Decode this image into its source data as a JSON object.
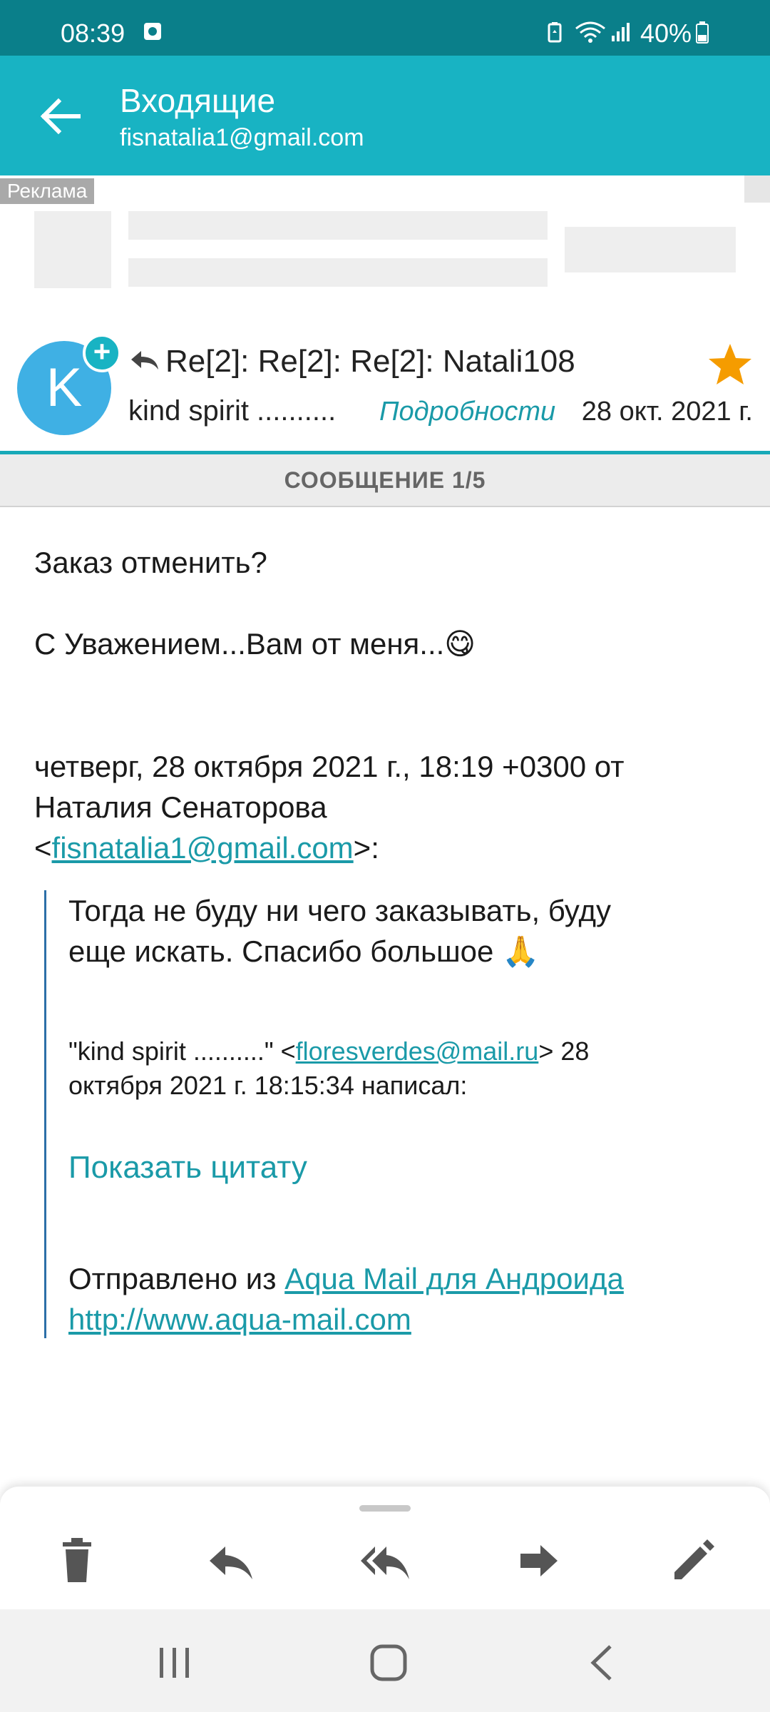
{
  "status_bar": {
    "time": "08:39",
    "battery": "40%",
    "icons": [
      "screenshot-icon",
      "battery-saver-icon",
      "wifi-icon",
      "signal-icon",
      "battery-icon"
    ]
  },
  "app_bar": {
    "title": "Входящие",
    "account": "fisnatalia1@gmail.com"
  },
  "ad": {
    "label": "Реклама"
  },
  "message_header": {
    "avatar_letter": "K",
    "subject": "Re[2]: Re[2]: Re[2]: Natali108",
    "sender": "kind spirit ..........",
    "details_link": "Подробности",
    "date": "28 окт. 2021 г.",
    "starred": true,
    "colors": {
      "accent": "#18b3c3",
      "star": "#f59c00",
      "avatar": "#3fb0e4"
    }
  },
  "counter": "СООБЩЕНИЕ 1/5",
  "body": {
    "line1": "Заказ отменить?",
    "line2": "С Уважением...Вам от меня...😋",
    "reply_header_1": "четверг, 28 октября 2021 г., 18:19 +0300 от",
    "reply_header_2": "Наталия Сенаторова",
    "reply_email": "fisnatalia1@gmail.com",
    "reply_lt": "<",
    "reply_gt": ">:",
    "quote_line1": "Тогда не буду ни чего заказывать, буду",
    "quote_line2": "еще искать. Спасибо большое 🙏",
    "attrib_prefix": "\"kind spirit ..........\" <",
    "attrib_email": "floresverdes@mail.ru",
    "attrib_suffix": "> 28",
    "attrib_line2": "октября 2021 г. 18:15:34 написал:",
    "show_quote": "Показать цитату",
    "sent_from": "Отправлено из ",
    "sent_link": "Aqua Mail для Андроида",
    "site_link": "http://www.aqua-mail.com"
  },
  "toolbar": {
    "buttons": [
      "delete-icon",
      "reply-icon",
      "reply-all-icon",
      "forward-icon",
      "edit-icon"
    ]
  },
  "nav_bar": {
    "buttons": [
      "recent-apps-icon",
      "home-icon",
      "back-icon"
    ]
  }
}
